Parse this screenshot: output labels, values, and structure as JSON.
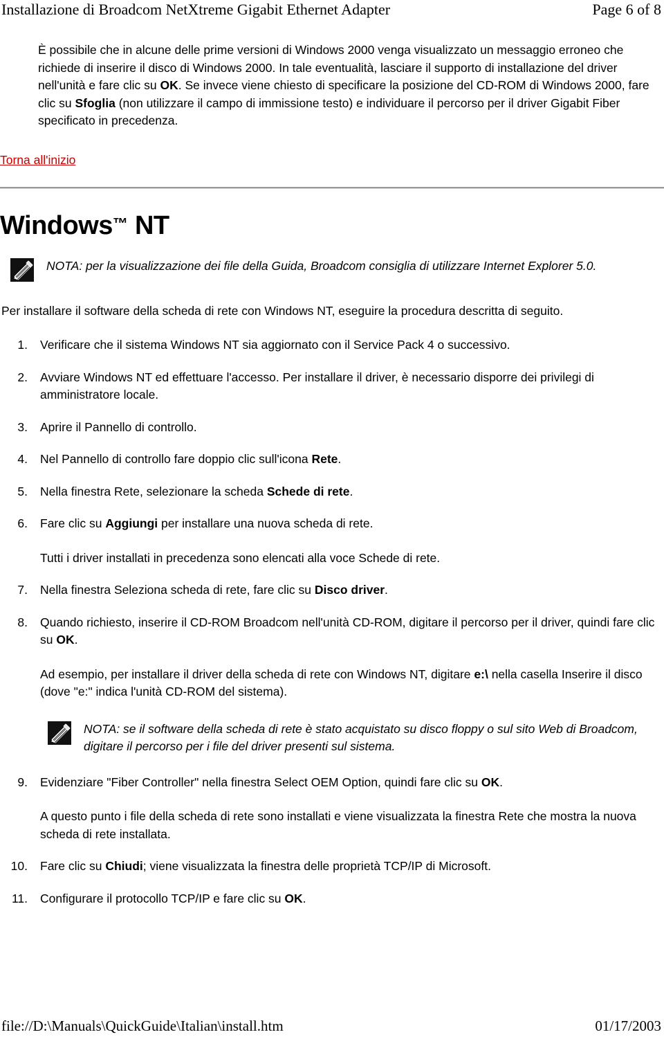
{
  "header": {
    "title": "Installazione di Broadcom NetXtreme Gigabit Ethernet Adapter",
    "page_label": "Page 6 of 8"
  },
  "intro": {
    "part1": "È possibile che in alcune delle prime versioni di Windows 2000 venga visualizzato un messaggio erroneo che richiede di inserire il disco di Windows 2000. In tale eventualità, lasciare il supporto di installazione del driver nell'unità e fare clic su ",
    "bold1": "OK",
    "part2": ". Se invece viene chiesto di specificare la posizione del CD-ROM di Windows 2000, fare clic su ",
    "bold2": "Sfoglia",
    "part3": " (non utilizzare il campo di immissione testo) e individuare il percorso per il driver Gigabit Fiber specificato in precedenza."
  },
  "back_link": {
    "label": "Torna all'inizio"
  },
  "section": {
    "title_main": "Windows",
    "title_tm": "™",
    "title_rest": " NT"
  },
  "note_1": {
    "icon": "note-pencil-icon",
    "text": "NOTA: per la visualizzazione dei file della Guida, Broadcom consiglia di utilizzare Internet Explorer 5.0."
  },
  "lead": {
    "text": "Per installare il software della scheda di rete con Windows NT, eseguire la procedura descritta di seguito."
  },
  "steps": [
    {
      "num": "1.",
      "part1": "Verificare che il sistema Windows NT sia aggiornato con il Service Pack 4 o successivo.",
      "bold": "",
      "part2": ""
    },
    {
      "num": "2.",
      "part1": "Avviare Windows NT ed effettuare l'accesso. Per installare il driver, è necessario disporre dei privilegi di amministratore locale.",
      "bold": "",
      "part2": ""
    },
    {
      "num": "3.",
      "part1": "Aprire il Pannello di controllo.",
      "bold": "",
      "part2": ""
    },
    {
      "num": "4.",
      "part1": "Nel Pannello di controllo fare doppio clic sull'icona ",
      "bold": "Rete",
      "part2": "."
    },
    {
      "num": "5.",
      "part1": "Nella finestra Rete, selezionare la scheda ",
      "bold": "Schede di rete",
      "part2": "."
    },
    {
      "num": "6.",
      "part1": "Fare clic su ",
      "bold": "Aggiungi",
      "part2": " per installare una nuova scheda di rete.",
      "sub": "Tutti i driver installati in precedenza sono elencati alla voce Schede di rete."
    },
    {
      "num": "7.",
      "part1": "Nella finestra Seleziona scheda di rete, fare clic su ",
      "bold": "Disco driver",
      "part2": "."
    },
    {
      "num": "8.",
      "part1": "Quando richiesto, inserire il CD-ROM Broadcom nell'unità CD-ROM, digitare il percorso per il driver, quindi fare clic su ",
      "bold": "OK",
      "part2": ".",
      "sub_a": "Ad esempio, per installare il driver della scheda di rete con Windows NT, digitare ",
      "sub_bold": "e:\\",
      "sub_b": " nella casella Inserire il disco (dove \"e:\" indica l'unità CD-ROM del sistema)."
    },
    {
      "num": "9.",
      "part1": "Evidenziare \"Fiber Controller\" nella finestra Select OEM Option, quindi fare clic su ",
      "bold": "OK",
      "part2": ".",
      "sub": "A questo punto i file della scheda di rete sono installati e viene visualizzata la finestra Rete che mostra la nuova scheda di rete installata."
    },
    {
      "num": "10.",
      "part1": "Fare clic su ",
      "bold": "Chiudi",
      "part2": "; viene visualizzata la finestra delle proprietà TCP/IP di Microsoft."
    },
    {
      "num": "11.",
      "part1": "Configurare il protocollo TCP/IP e fare clic su ",
      "bold": "OK",
      "part2": "."
    }
  ],
  "note_2": {
    "icon": "note-pencil-icon",
    "text": "NOTA: se il software della scheda di rete è stato acquistato su disco floppy o sul sito Web di Broadcom, digitare il percorso per i file del driver presenti sul sistema."
  },
  "footer": {
    "path": "file://D:\\Manuals\\QuickGuide\\Italian\\install.htm",
    "date": "01/17/2003"
  },
  "colors": {
    "link": "#cc0000",
    "rule": "#9a9a9a",
    "text": "#000000"
  }
}
